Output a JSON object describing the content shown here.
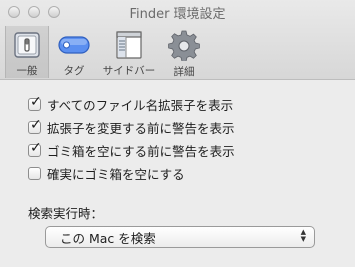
{
  "window": {
    "title": "Finder 環境設定"
  },
  "tabs": [
    {
      "label": "一般",
      "icon": "switch-icon",
      "selected": true
    },
    {
      "label": "タグ",
      "icon": "tag-icon",
      "selected": false
    },
    {
      "label": "サイドバー",
      "icon": "sidebar-icon",
      "selected": false
    },
    {
      "label": "詳細",
      "icon": "gear-icon",
      "selected": false
    }
  ],
  "options": [
    {
      "label": "すべてのファイル名拡張子を表示",
      "checked": true
    },
    {
      "label": "拡張子を変更する前に警告を表示",
      "checked": true
    },
    {
      "label": "ゴミ箱を空にする前に警告を表示",
      "checked": true
    },
    {
      "label": "確実にゴミ箱を空にする",
      "checked": false
    }
  ],
  "search": {
    "label": "検索実行時：",
    "selected": "この Mac を検索"
  },
  "colors": {
    "accent": "#3b7ded"
  }
}
